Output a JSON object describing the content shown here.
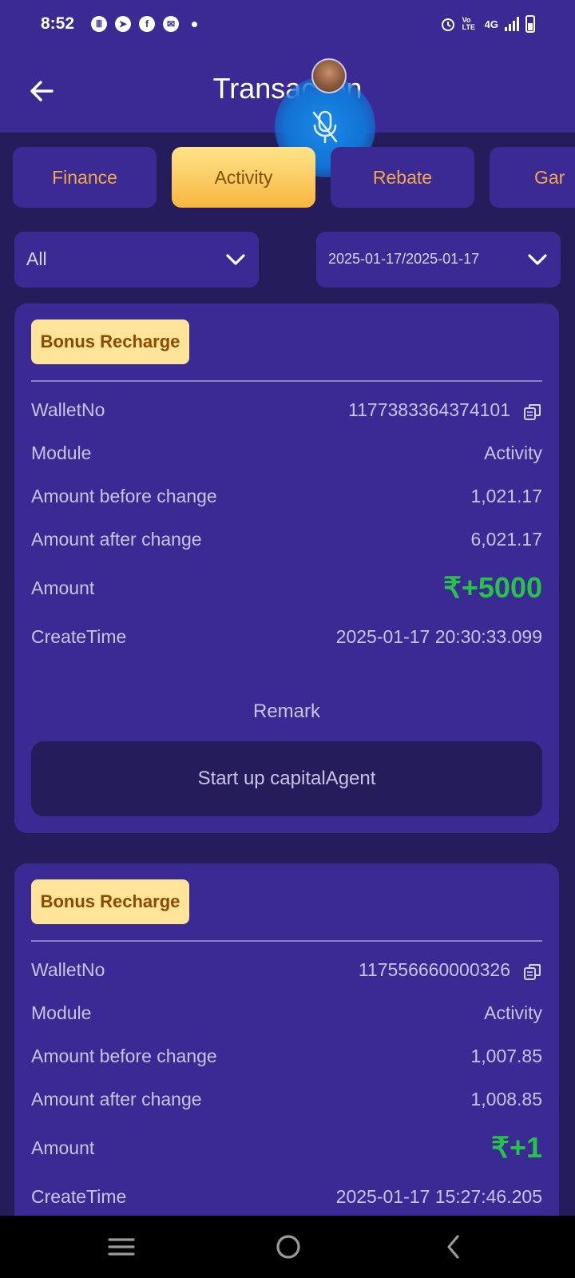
{
  "status_bar": {
    "time": "8:52",
    "network_label": "4G",
    "volte_label": "Vo LTE"
  },
  "header": {
    "title": "Transaction"
  },
  "tabs": [
    {
      "label": "Finance",
      "active": false
    },
    {
      "label": "Activity",
      "active": true
    },
    {
      "label": "Rebate",
      "active": false
    },
    {
      "label": "Gar",
      "active": false
    }
  ],
  "filters": {
    "type": {
      "value": "All"
    },
    "date": {
      "value": "2025-01-17/2025-01-17"
    }
  },
  "field_labels": {
    "wallet_no": "WalletNo",
    "module": "Module",
    "amount_before": "Amount before change",
    "amount_after": "Amount after change",
    "amount": "Amount",
    "create_time": "CreateTime",
    "remark": "Remark"
  },
  "records": [
    {
      "badge": "Bonus Recharge",
      "wallet_no": "1177383364374101",
      "module": "Activity",
      "amount_before": "1,021.17",
      "amount_after": "6,021.17",
      "amount": "₹+5000",
      "create_time": "2025-01-17 20:30:33.099",
      "remark": "Start up capitalAgent"
    },
    {
      "badge": "Bonus Recharge",
      "wallet_no": "117556660000326",
      "module": "Activity",
      "amount_before": "1,007.85",
      "amount_after": "1,008.85",
      "amount": "₹+1",
      "create_time": "2025-01-17 15:27:46.205"
    }
  ],
  "colors": {
    "header_bg": "#3b2a93",
    "page_bg": "#251c5b",
    "tab_text": "#f2a84a",
    "active_tab_gradient": [
      "#ffe38a",
      "#f8b640"
    ],
    "badge_bg": "#ffe49a",
    "amount_positive": "#26c24a",
    "voice_button": "#1a8ae8"
  },
  "icons": {
    "back": "arrow-left-icon",
    "dropdown": "chevron-down-icon",
    "copy": "copy-icon",
    "voice_overlay": "mic-off-icon",
    "nav_recents": "menu-lines-icon",
    "nav_home": "circle-home-icon",
    "nav_back": "chevron-left-icon"
  }
}
